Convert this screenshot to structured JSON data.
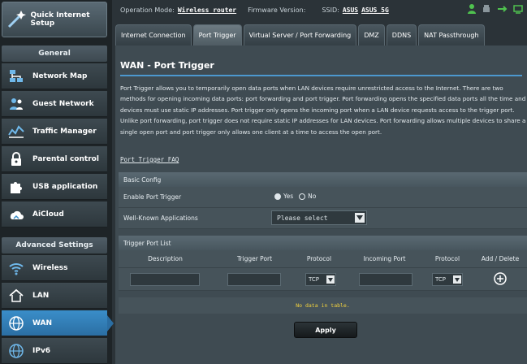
{
  "topbar": {
    "operation_mode_label": "Operation Mode:",
    "operation_mode_value": "Wireless router",
    "firmware_label": "Firmware Version:",
    "ssid_label": "SSID:",
    "ssid_1": "ASUS",
    "ssid_2": "ASUS_5G"
  },
  "sidebar": {
    "qis_label": "Quick Internet Setup",
    "general_title": "General",
    "general_items": [
      {
        "label": "Network Map",
        "icon": "network-map-icon"
      },
      {
        "label": "Guest Network",
        "icon": "guest-network-icon"
      },
      {
        "label": "Traffic Manager",
        "icon": "traffic-manager-icon"
      },
      {
        "label": "Parental control",
        "icon": "lock-icon"
      },
      {
        "label": "USB application",
        "icon": "puzzle-icon"
      },
      {
        "label": "AiCloud",
        "icon": "cloud-house-icon"
      }
    ],
    "advanced_title": "Advanced Settings",
    "advanced_items": [
      {
        "label": "Wireless",
        "icon": "wifi-icon"
      },
      {
        "label": "LAN",
        "icon": "house-icon"
      },
      {
        "label": "WAN",
        "icon": "globe-icon",
        "active": true
      },
      {
        "label": "IPv6",
        "icon": "globe-icon"
      }
    ]
  },
  "tabs": [
    {
      "label": "Internet Connection"
    },
    {
      "label": "Port Trigger",
      "active": true
    },
    {
      "label": "Virtual Server / Port Forwarding"
    },
    {
      "label": "DMZ"
    },
    {
      "label": "DDNS"
    },
    {
      "label": "NAT Passthrough"
    }
  ],
  "main": {
    "title": "WAN - Port Trigger",
    "description": "Port Trigger allows you to temporarily open data ports when LAN devices require unrestricted access to the Internet. There are two methods for opening incoming data ports: port forwarding and port trigger. Port forwarding opens the specified data ports all the time and devices must use static IP addresses. Port trigger only opens the incoming port when a LAN device requests access to the trigger port. Unlike port forwarding, port trigger does not require static IP addresses for LAN devices. Port forwarding allows multiple devices to share a single open port and port trigger only allows one client at a time to access the open port.",
    "faq_link": "Port Trigger FAQ",
    "basic_config": {
      "title": "Basic Config",
      "enable_label": "Enable Port Trigger",
      "yes_label": "Yes",
      "no_label": "No",
      "enabled": true,
      "apps_label": "Well-Known Applications",
      "apps_value": "Please select"
    },
    "trigger_list": {
      "title": "Trigger Port List",
      "columns": [
        "Description",
        "Trigger Port",
        "Protocol",
        "Incoming Port",
        "Protocol",
        "Add / Delete"
      ],
      "protocol_1": "TCP",
      "protocol_2": "TCP",
      "no_data": "No data in table."
    },
    "apply_label": "Apply"
  },
  "colors": {
    "accent": "#3a8ec9",
    "panel": "#3f4b52",
    "nodata": "#f4d33e"
  }
}
